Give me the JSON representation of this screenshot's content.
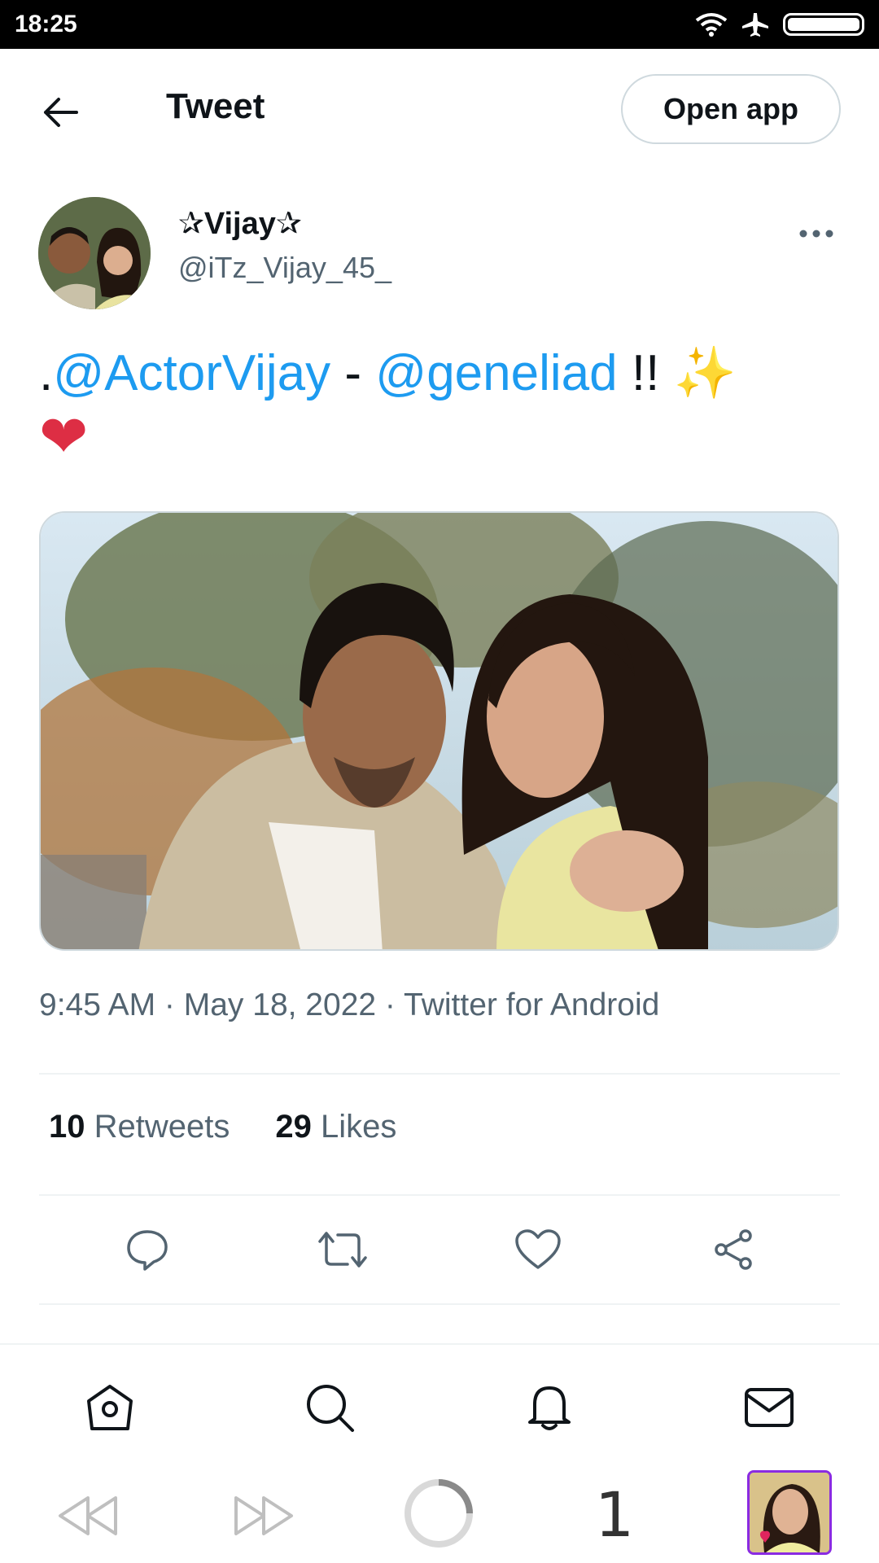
{
  "status_bar": {
    "time": "18:25"
  },
  "header": {
    "title": "Tweet",
    "open_app_label": "Open app"
  },
  "author": {
    "display_name": "✰Vijay✰",
    "handle": "@iTz_Vijay_45_"
  },
  "tweet": {
    "prefix": ".",
    "mention_1": "@ActorVijay",
    "separator": " - ",
    "mention_2": "@geneliad",
    "suffix": " !! ",
    "emoji_sparkles": "✨",
    "emoji_heart": "❤"
  },
  "meta": {
    "text": "9:45 AM · May 18, 2022 · Twitter for Android"
  },
  "stats": {
    "retweets_count": "10",
    "retweets_label": "Retweets",
    "likes_count": "29",
    "likes_label": "Likes"
  },
  "browser": {
    "tab_count": "1"
  },
  "colors": {
    "accent": "#1d9bf0",
    "text": "#0f1419",
    "secondary": "#536471",
    "heart": "#e0245e"
  }
}
